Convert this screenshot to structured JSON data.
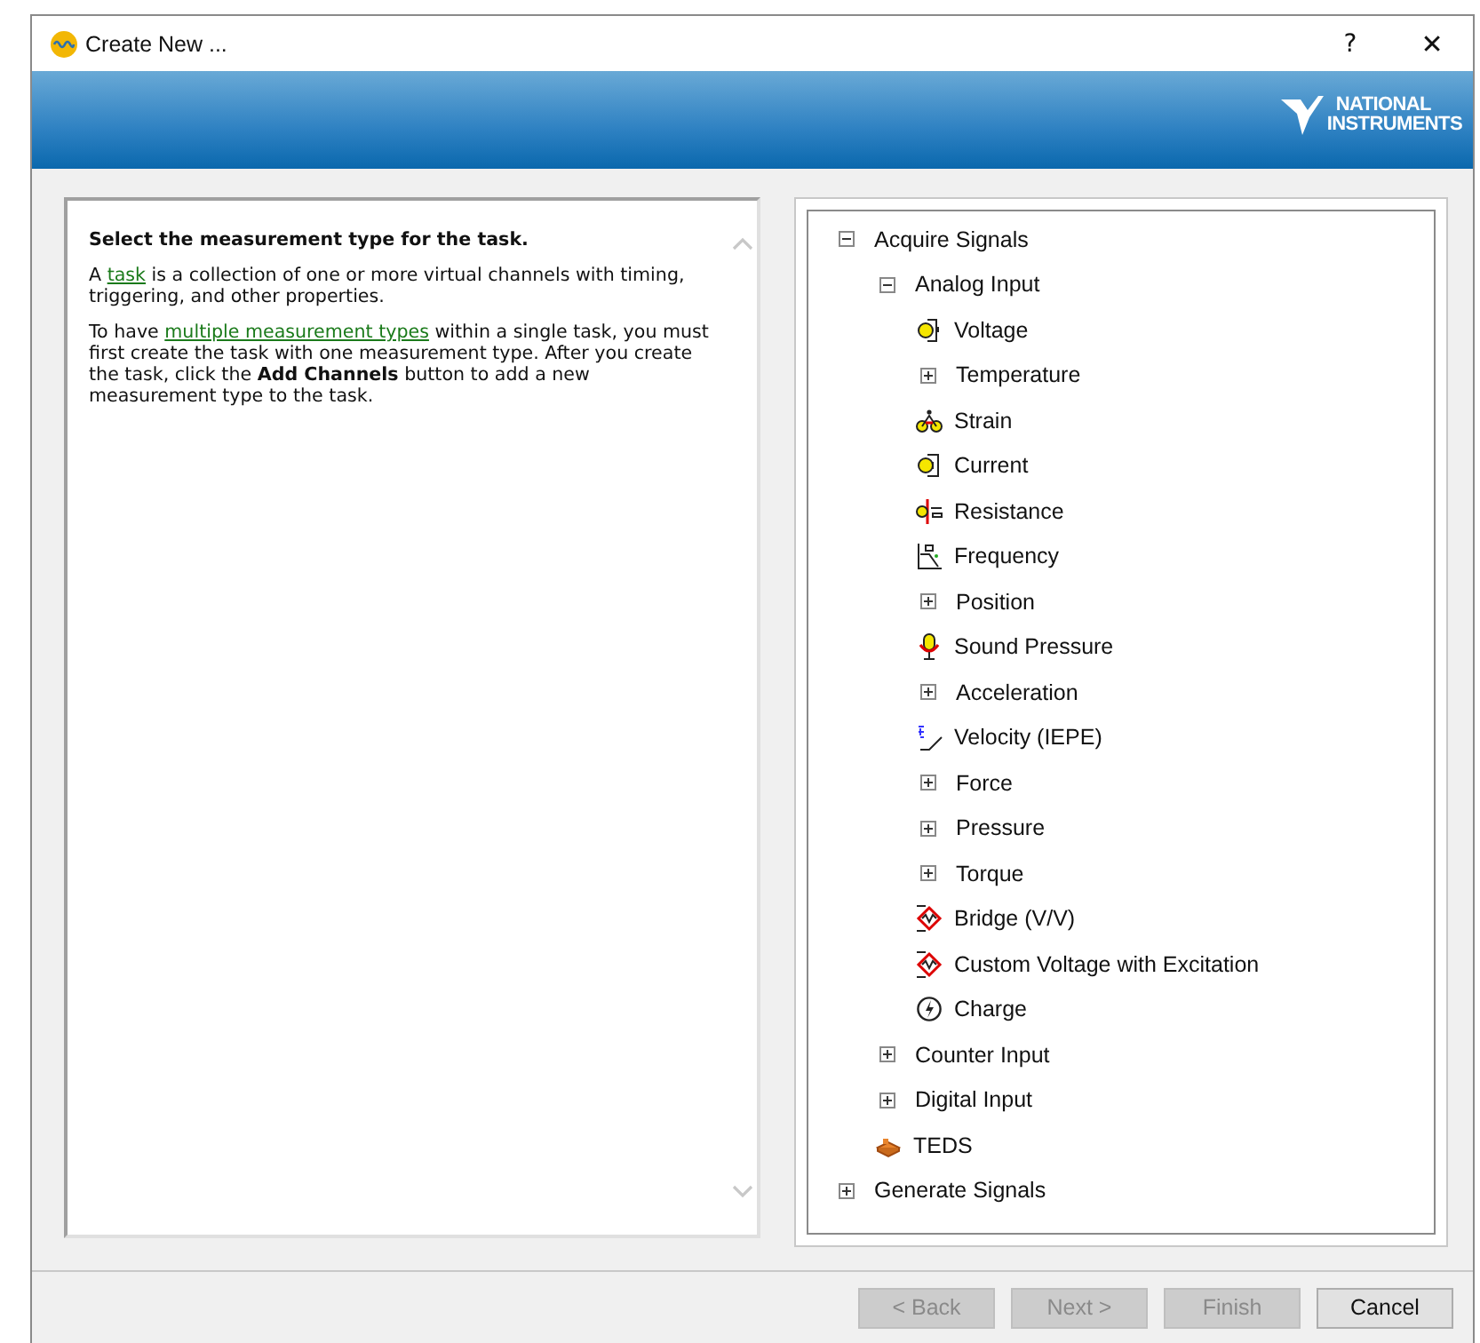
{
  "window": {
    "title": "Create New ...",
    "help_button": "?",
    "close_button": "✕"
  },
  "banner": {
    "logo_lines": [
      "NATIONAL",
      "INSTRUMENTS"
    ]
  },
  "help": {
    "heading": "Select the measurement type for the task.",
    "paragraphs": [
      [
        {
          "kind": "plain",
          "text": "A "
        },
        {
          "kind": "link",
          "text": "task"
        },
        {
          "kind": "plain",
          "text": " is a collection of one or more virtual channels with timing, triggering, and other properties."
        }
      ],
      [
        {
          "kind": "plain",
          "text": "To have "
        },
        {
          "kind": "link",
          "text": "multiple measurement types"
        },
        {
          "kind": "plain",
          "text": " within a single task, you must first create the task with one measurement type. After you create the task, click the "
        },
        {
          "kind": "bold",
          "text": "Add Channels"
        },
        {
          "kind": "plain",
          "text": " button to add a new measurement type to the task."
        }
      ]
    ]
  },
  "tree": [
    {
      "label": "Acquire Signals",
      "expanded": true,
      "children": [
        {
          "label": "Analog Input",
          "expanded": true,
          "children": [
            {
              "label": "Voltage",
              "kind": "voltage"
            },
            {
              "label": "Temperature",
              "expanded": false
            },
            {
              "label": "Strain",
              "kind": "strain"
            },
            {
              "label": "Current",
              "kind": "current"
            },
            {
              "label": "Resistance",
              "kind": "resistance"
            },
            {
              "label": "Frequency",
              "kind": "frequency"
            },
            {
              "label": "Position",
              "expanded": false
            },
            {
              "label": "Sound Pressure",
              "kind": "microphone"
            },
            {
              "label": "Acceleration",
              "expanded": false
            },
            {
              "label": "Velocity (IEPE)",
              "kind": "velocity"
            },
            {
              "label": "Force",
              "expanded": false
            },
            {
              "label": "Pressure",
              "expanded": false
            },
            {
              "label": "Torque",
              "expanded": false
            },
            {
              "label": "Bridge (V/V)",
              "kind": "bridge"
            },
            {
              "label": "Custom Voltage with Excitation",
              "kind": "bridge"
            },
            {
              "label": "Charge",
              "kind": "charge"
            }
          ]
        },
        {
          "label": "Counter Input",
          "expanded": false
        },
        {
          "label": "Digital Input",
          "expanded": false
        },
        {
          "label": "TEDS",
          "kind": "teds"
        }
      ]
    },
    {
      "label": "Generate Signals",
      "expanded": false
    }
  ],
  "buttons": [
    {
      "label": "< Back",
      "disabled": true
    },
    {
      "label": "Next >",
      "disabled": true
    },
    {
      "label": "Finish",
      "disabled": true
    },
    {
      "label": "Cancel",
      "disabled": false
    }
  ]
}
